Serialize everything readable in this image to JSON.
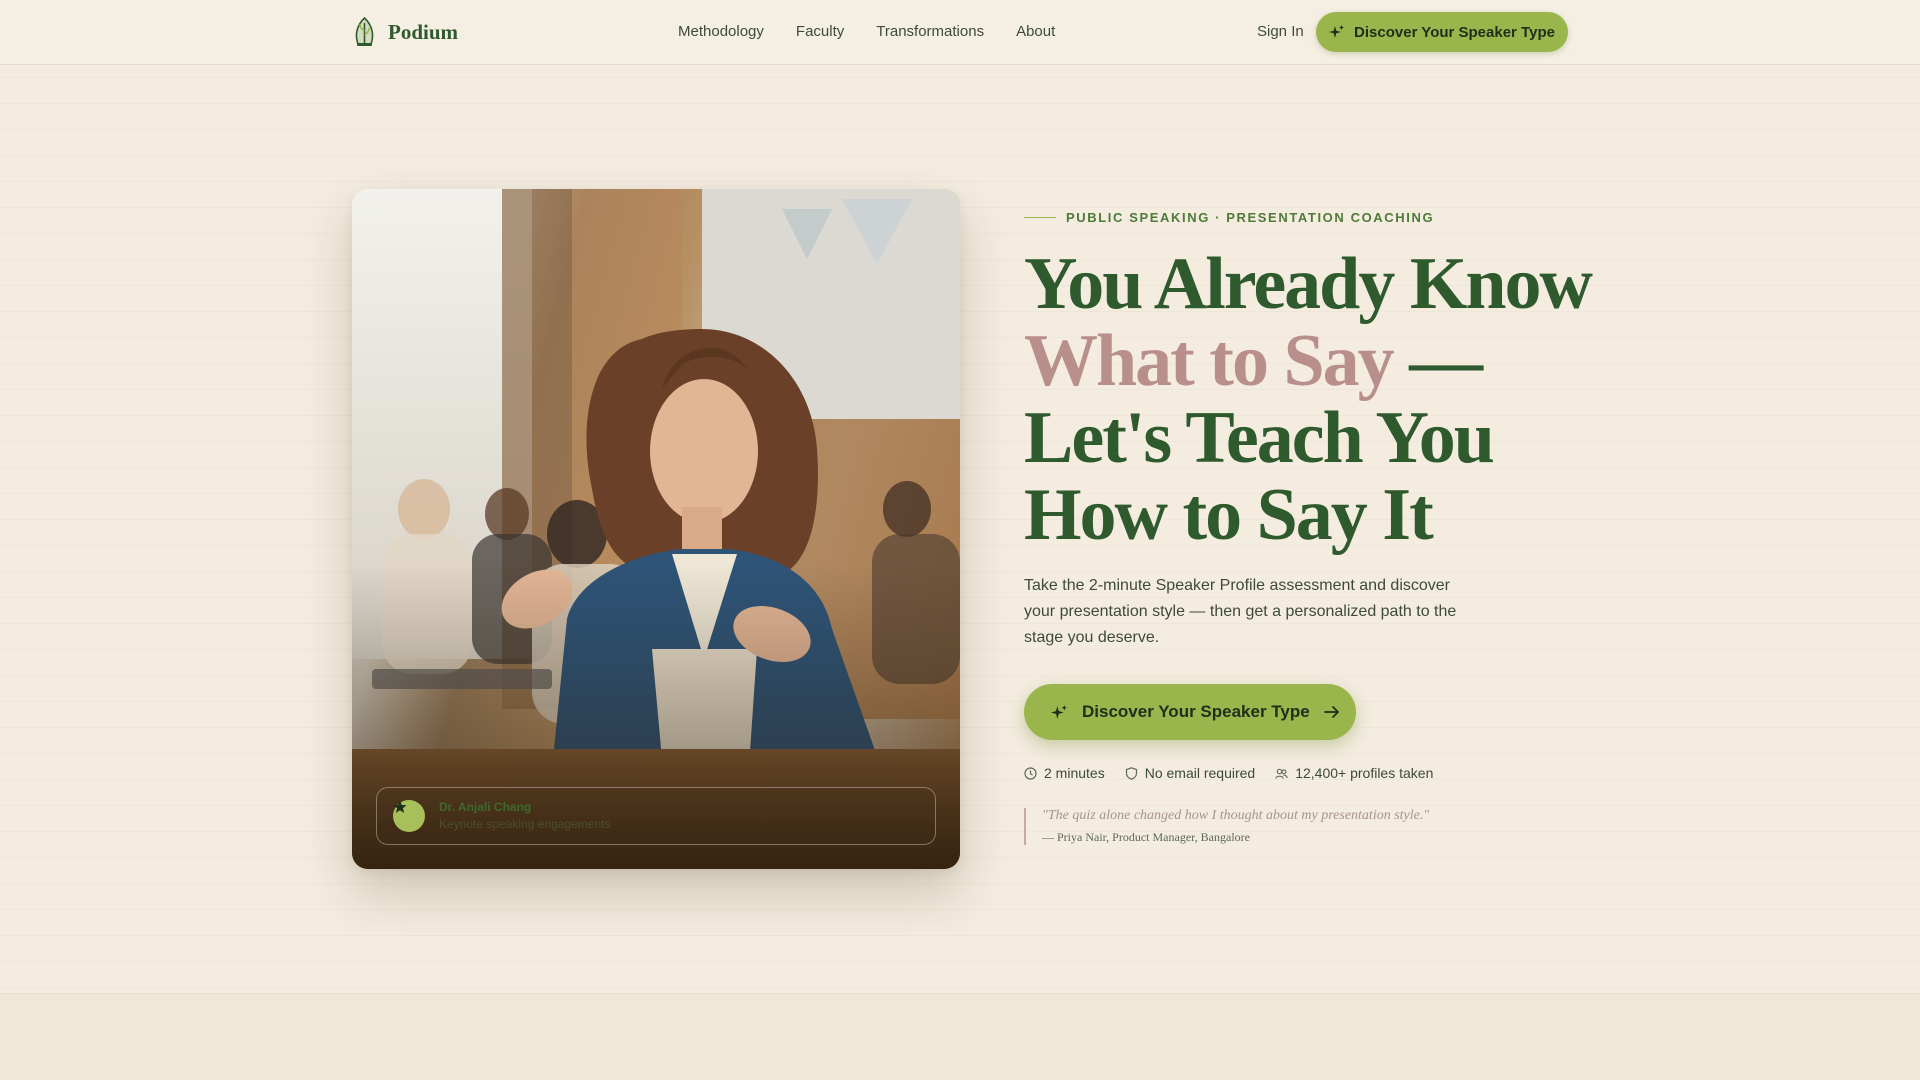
{
  "header": {
    "brand": "Podium",
    "logo_icon": "podium-leaf-logo",
    "nav": [
      "Methodology",
      "Faculty",
      "Transformations",
      "About"
    ],
    "sign_in": "Sign In",
    "cta": "Discover Your Speaker Type"
  },
  "hero": {
    "eyebrow": "PUBLIC SPEAKING · PRESENTATION COACHING",
    "headline_1": "You Already Know",
    "headline_accent": "What to Say",
    "headline_2": " —",
    "headline_3": "Let's Teach You",
    "headline_4": "How to Say It",
    "lead": "Take the 2-minute Speaker Profile assessment and discover your presentation style — then get a personalized path to the stage you deserve.",
    "cta": "Discover Your Speaker Type",
    "meta": [
      {
        "icon": "clock-icon",
        "text": "2 minutes"
      },
      {
        "icon": "shield-icon",
        "text": "No email required"
      },
      {
        "icon": "people-icon",
        "text": "12,400+ profiles taken"
      }
    ],
    "quote": "\"The quiz alone changed how I thought about my presentation style.\"",
    "quote_author": "— Priya Nair, Product Manager, Bangalore"
  },
  "photo": {
    "card_title": "Dr. Anjali Chang",
    "card_subtitle": "Keynote speaking engagements"
  },
  "colors": {
    "background": "#f3ecdf",
    "brand_green": "#2e5a2e",
    "accent_lime": "#9bb54d",
    "accent_rose": "#b88f8a"
  }
}
